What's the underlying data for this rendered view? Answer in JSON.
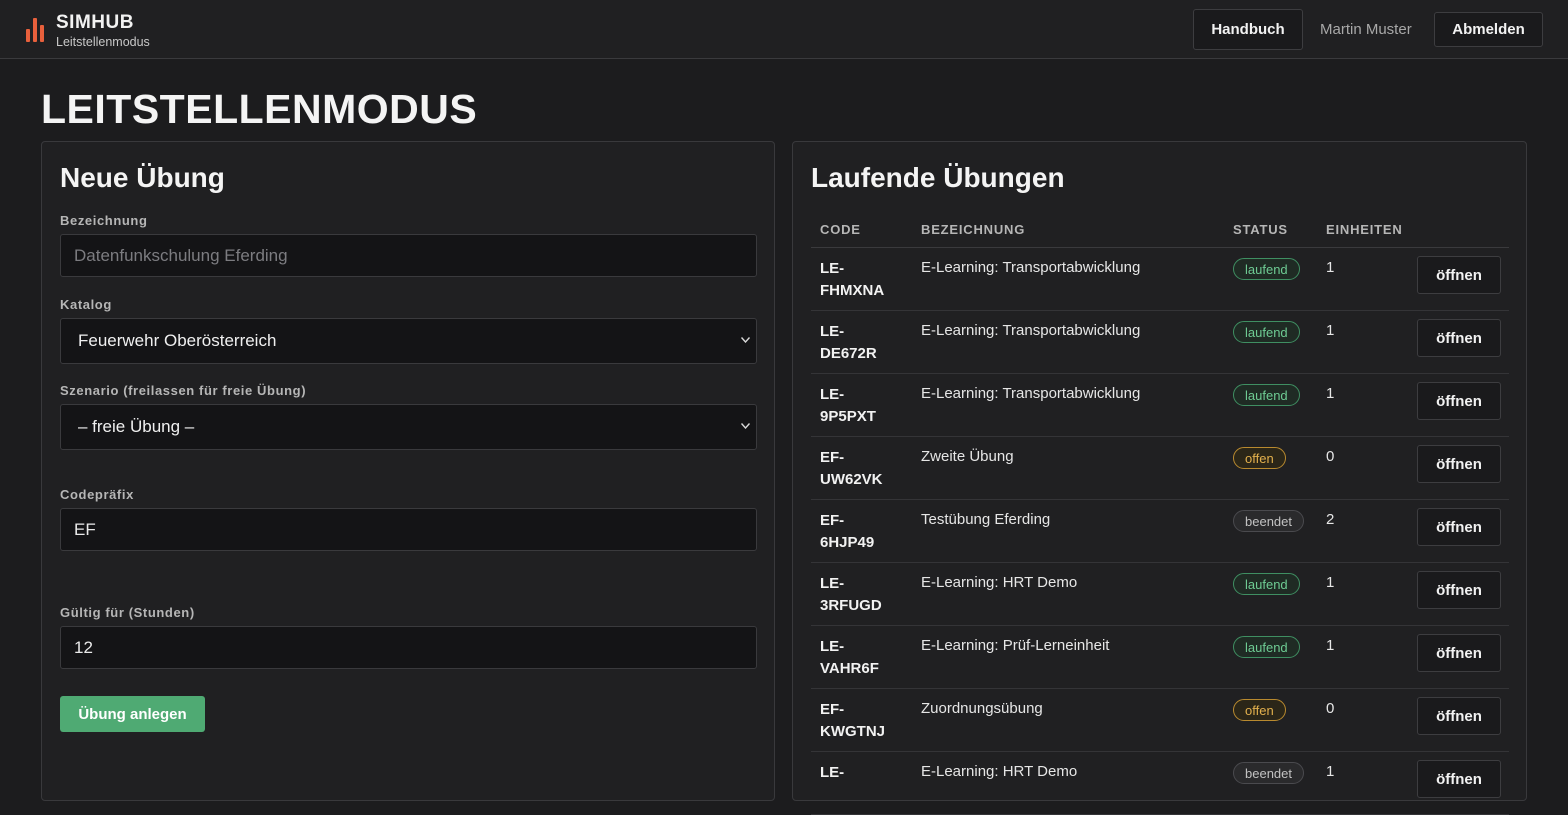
{
  "header": {
    "brand": "SIMHUB",
    "subtitle": "Leitstellenmodus",
    "manual_button": "Handbuch",
    "user_name": "Martin Muster",
    "logout_button": "Abmelden",
    "accent_color": "#e8603c"
  },
  "page": {
    "title": "LEITSTELLENMODUS"
  },
  "new_exercise": {
    "title": "Neue Übung",
    "name_label": "Bezeichnung",
    "name_placeholder": "Datenfunkschulung Eferding",
    "name_value": "",
    "catalog_label": "Katalog",
    "catalog_value": "Feuerwehr Oberösterreich",
    "scenario_label": "Szenario (freilassen für freie Übung)",
    "scenario_value": "– freie Übung –",
    "prefix_label": "Codepräfix",
    "prefix_value": "EF",
    "valid_label": "Gültig für (Stunden)",
    "valid_value": "12",
    "submit_label": "Übung anlegen",
    "submit_color": "#4faa73"
  },
  "running": {
    "title": "Laufende Übungen",
    "columns": {
      "code": "CODE",
      "name": "BEZEICHNUNG",
      "status": "STATUS",
      "units": "EINHEITEN"
    },
    "rows": [
      {
        "code_line1": "LE-",
        "code_line2": "FHMXNA",
        "name": "E-Learning: Transportabwicklung",
        "status": "laufend",
        "units": "1",
        "action": "öffnen"
      },
      {
        "code_line1": "LE-",
        "code_line2": "DE672R",
        "name": "E-Learning: Transportabwicklung",
        "status": "laufend",
        "units": "1",
        "action": "öffnen"
      },
      {
        "code_line1": "LE-",
        "code_line2": "9P5PXT",
        "name": "E-Learning: Transportabwicklung",
        "status": "laufend",
        "units": "1",
        "action": "öffnen"
      },
      {
        "code_line1": "EF-",
        "code_line2": "UW62VK",
        "name": "Zweite Übung",
        "status": "offen",
        "units": "0",
        "action": "öffnen"
      },
      {
        "code_line1": "EF-",
        "code_line2": "6HJP49",
        "name": "Testübung Eferding",
        "status": "beendet",
        "units": "2",
        "action": "öffnen"
      },
      {
        "code_line1": "LE-",
        "code_line2": "3RFUGD",
        "name": "E-Learning: HRT Demo",
        "status": "laufend",
        "units": "1",
        "action": "öffnen"
      },
      {
        "code_line1": "LE-",
        "code_line2": "VAHR6F",
        "name": "E-Learning: Prüf-Lerneinheit",
        "status": "laufend",
        "units": "1",
        "action": "öffnen"
      },
      {
        "code_line1": "EF-",
        "code_line2": "KWGTNJ",
        "name": "Zuordnungsübung",
        "status": "offen",
        "units": "0",
        "action": "öffnen"
      },
      {
        "code_line1": "LE-",
        "code_line2": "",
        "name": "E-Learning: HRT Demo",
        "status": "beendet",
        "units": "1",
        "action": "öffnen"
      }
    ]
  }
}
